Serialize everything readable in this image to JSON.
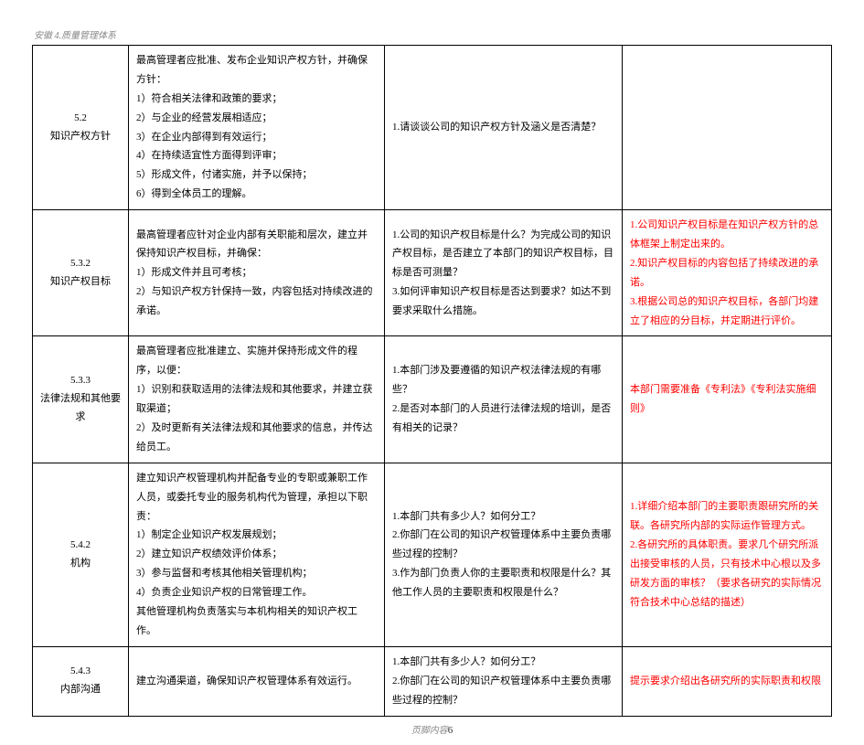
{
  "header": "安徽 4.质量管理体系",
  "footer_label": "页脚内容",
  "footer_page": "6",
  "rows": [
    {
      "section_no": "5.2",
      "section_title": "知识产权方针",
      "standard": "最高管理者应批准、发布企业知识产权方针，并确保方针：\n1）符合相关法律和政策的要求；\n2）与企业的经营发展相适应；\n3）在企业内部得到有效运行；\n4）在持续适宜性方面得到评审；\n5）形成文件，付诸实施，并予以保持；\n6）得到全体员工的理解。",
      "question": "1.请谈谈公司的知识产权方针及涵义是否清楚？",
      "remark": ""
    },
    {
      "section_no": "5.3.2",
      "section_title": "知识产权目标",
      "standard": "最高管理者应针对企业内部有关职能和层次，建立并保持知识产权目标，并确保：\n1）形成文件并且可考核；\n2）与知识产权方针保持一致，内容包括对持续改进的承诺。",
      "question": "1.公司的知识产权目标是什么？为完成公司的知识产权目标，是否建立了本部门的知识产权目标，目标是否可测量？\n3.如何评审知识产权目标是否达到要求？如达不到要求采取什么措施。",
      "remark": "1.公司知识产权目标是在知识产权方针的总体框架上制定出来的。\n2.知识产权目标的内容包括了持续改进的承诺。\n3.根据公司总的知识产权目标，各部门均建立了相应的分目标，并定期进行评价。"
    },
    {
      "section_no": "5.3.3",
      "section_title": "法律法规和其他要求",
      "standard": "最高管理者应批准建立、实施并保持形成文件的程序，以便：\n1）识别和获取适用的法律法规和其他要求，并建立获取渠道；\n2）及时更新有关法律法规和其他要求的信息，并传达给员工。",
      "question": "1.本部门涉及要遵循的知识产权法律法规的有哪些？\n2.是否对本部门的人员进行法律法规的培训，是否有相关的记录？",
      "remark": "本部门需要准备《专利法》《专利法实施细则》"
    },
    {
      "section_no": "5.4.2",
      "section_title": "机构",
      "standard": "建立知识产权管理机构并配备专业的专职或兼职工作人员，或委托专业的服务机构代为管理，承担以下职责：\n1）制定企业知识产权发展规划；\n2）建立知识产权绩效评价体系；\n3）参与监督和考核其他相关管理机构；\n4）负责企业知识产权的日常管理工作。\n其他管理机构负责落实与本机构相关的知识产权工作。",
      "question": "1.本部门共有多少人？如何分工？\n2.你部门在公司的知识产权管理体系中主要负责哪些过程的控制？\n3.作为部门负责人你的主要职责和权限是什么？其他工作人员的主要职责和权限是什么？",
      "remark": "1.详细介绍本部门的主要职责跟研究所的关联。各研究所内部的实际运作管理方式。\n2.各研究所的具体职责。要求几个研究所派出接受审核的人员，只有技术中心根以及多研发方面的审核？（要求各研究的实际情况符合技术中心总结的描述）"
    },
    {
      "section_no": "5.4.3",
      "section_title": "内部沟通",
      "standard": "建立沟通渠道，确保知识产权管理体系有效运行。",
      "question": "1.本部门共有多少人？如何分工？\n2.你部门在公司的知识产权管理体系中主要负责哪些过程的控制？",
      "remark": "提示要求介绍出各研究所的实际职责和权限"
    }
  ]
}
